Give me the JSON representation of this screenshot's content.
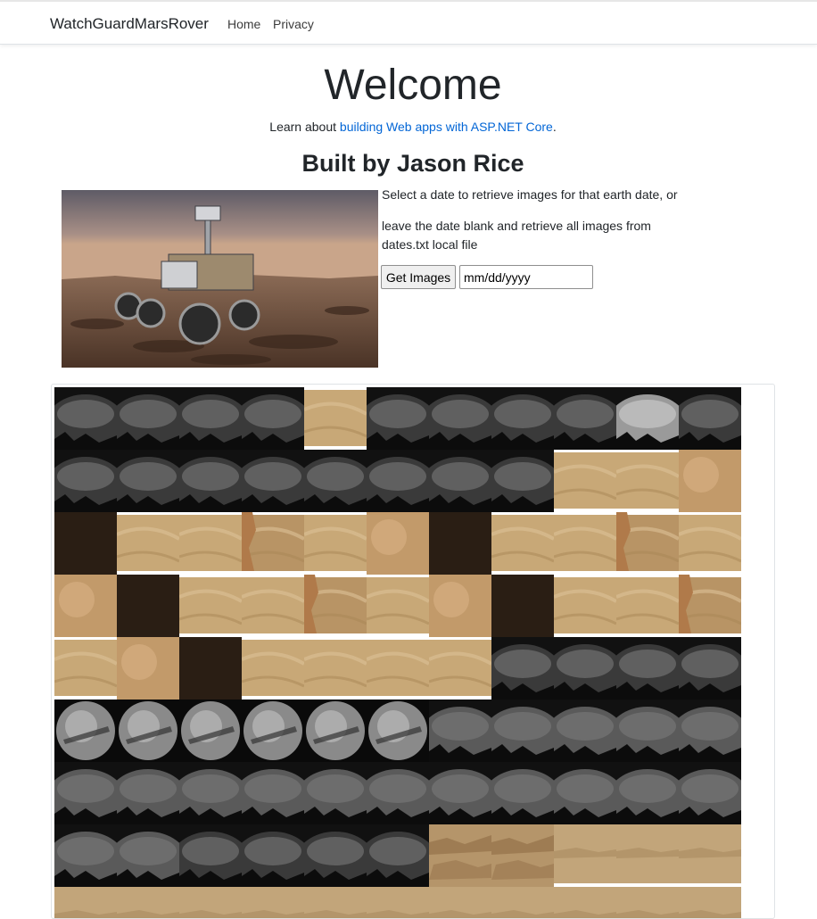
{
  "nav": {
    "brand": "WatchGuardMarsRover",
    "home": "Home",
    "privacy": "Privacy"
  },
  "main": {
    "welcome": "Welcome",
    "learn_prefix": "Learn about ",
    "learn_link": "building Web apps with ASP.NET Core",
    "learn_suffix": ".",
    "built_by": "Built by Jason Rice",
    "instructions_1": "Select a date to retrieve images for that earth date, or",
    "instructions_2": "leave the date blank and retrieve all images from dates.txt local file",
    "get_images_label": "Get Images",
    "date_placeholder": "mm/dd/yyyy"
  },
  "gallery": {
    "rows": [
      [
        "nav-cam",
        "nav-cam",
        "nav-cam",
        "nav-cam",
        "sand",
        "nav-cam",
        "nav-cam",
        "nav-cam",
        "nav-cam",
        "nav-cam-bright",
        "nav-cam"
      ],
      [
        "nav-cam",
        "nav-cam",
        "nav-cam",
        "nav-cam",
        "nav-cam",
        "nav-cam",
        "nav-cam",
        "nav-cam",
        "sand",
        "sand",
        "blur-tan"
      ],
      [
        "dark",
        "sand",
        "sand",
        "sand-rock",
        "sand",
        "blur-tan",
        "dark",
        "sand",
        "sand",
        "sand-rock",
        "sand"
      ],
      [
        "blur-tan",
        "dark",
        "sand",
        "sand",
        "sand-rock",
        "sand",
        "blur-tan",
        "dark",
        "sand",
        "sand",
        "sand-rock"
      ],
      [
        "sand",
        "blur-tan",
        "dark",
        "sand",
        "sand",
        "sand",
        "sand",
        "nav-cam",
        "nav-cam",
        "nav-cam",
        "nav-cam"
      ],
      [
        "fisheye",
        "fisheye",
        "fisheye",
        "fisheye",
        "fisheye",
        "fisheye",
        "hazcam",
        "hazcam",
        "hazcam",
        "hazcam",
        "hazcam"
      ],
      [
        "hazcam",
        "hazcam",
        "hazcam",
        "hazcam",
        "hazcam",
        "hazcam",
        "hazcam",
        "hazcam",
        "hazcam",
        "hazcam",
        "hazcam"
      ],
      [
        "hazcam",
        "hazcam",
        "nav-cam",
        "nav-cam",
        "nav-cam",
        "nav-cam",
        "mast-rocks",
        "mast-rocks",
        "mastcam",
        "mastcam",
        "mastcam"
      ],
      [
        "mastcam",
        "mastcam",
        "mastcam",
        "mastcam",
        "mastcam",
        "mastcam",
        "mastcam",
        "mastcam",
        "mastcam",
        "mastcam",
        "mastcam"
      ]
    ],
    "colors": {
      "nav-cam": "#3a3a3a",
      "nav-cam-bright": "#9a9a9a",
      "sand": "#c8a877",
      "sand-rock": "#b89465",
      "blur-tan": "#c29a6a",
      "dark": "#2a1e14",
      "fisheye": "#8a8a8a",
      "hazcam": "#5a5a5a",
      "mast-rocks": "#b5956a",
      "mastcam": "#c2a57a"
    }
  }
}
